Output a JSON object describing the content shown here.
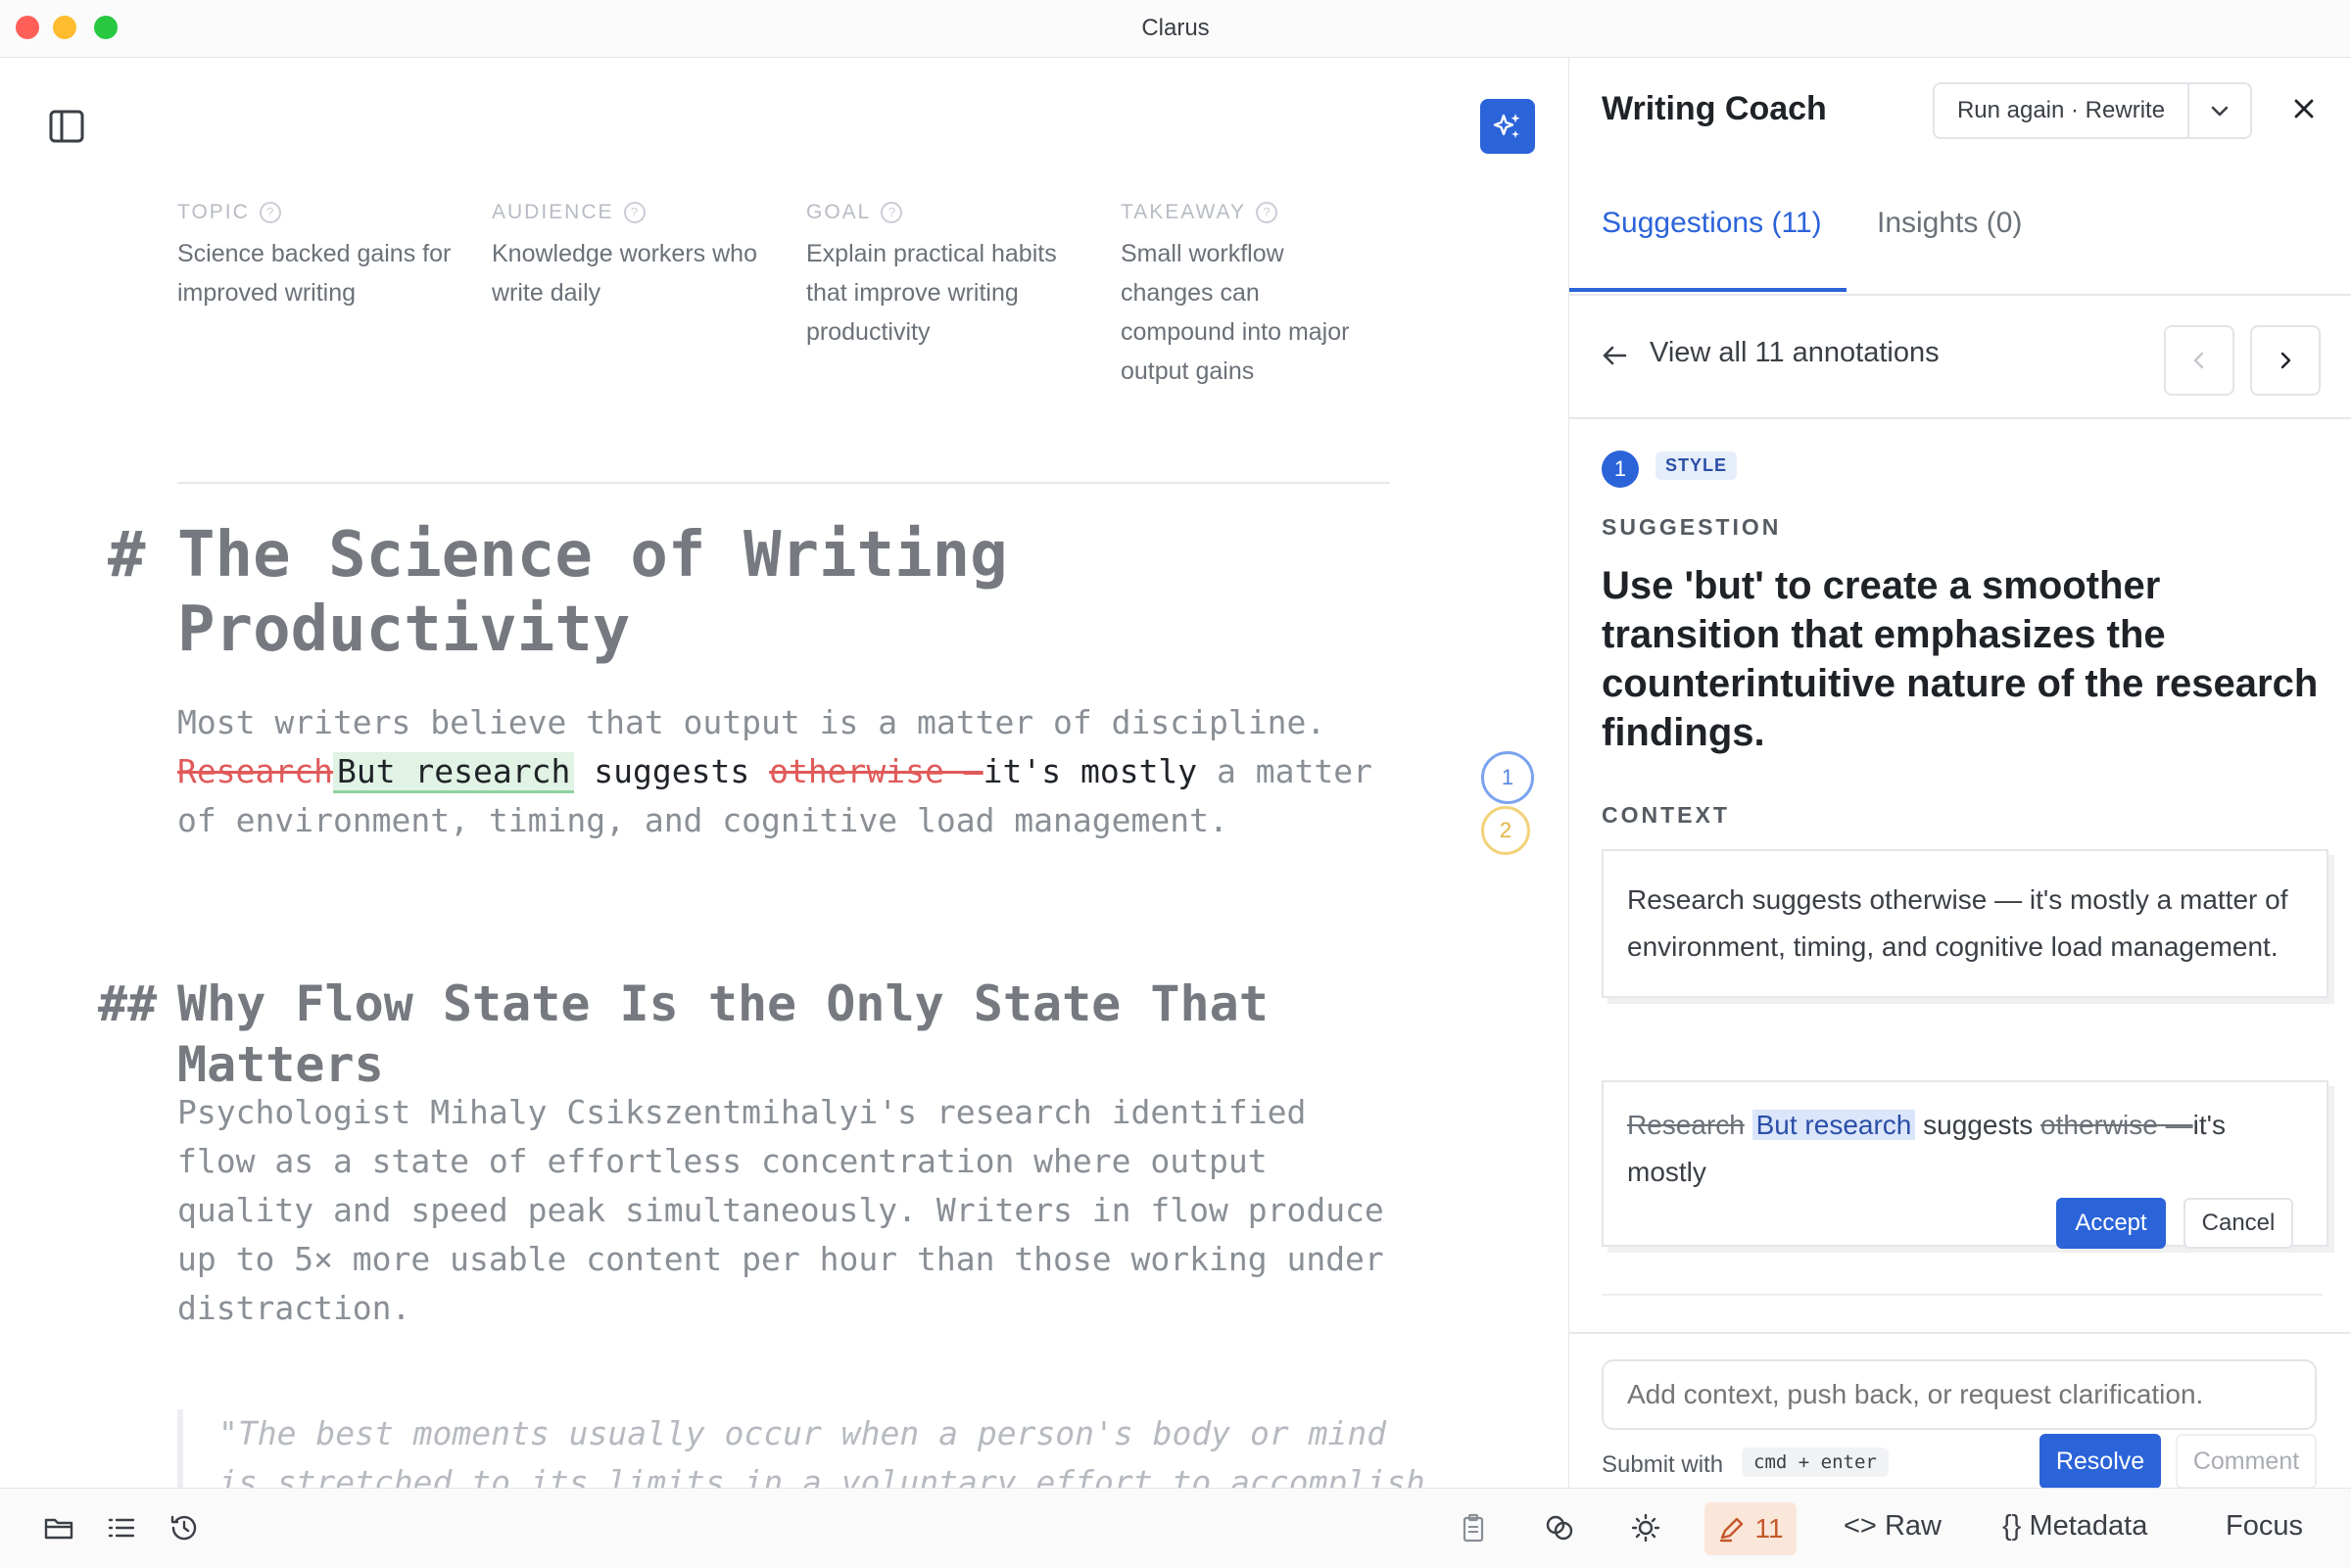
{
  "window": {
    "title": "Clarus"
  },
  "meta": [
    {
      "label": "TOPIC",
      "value": "Science backed gains for improved writing"
    },
    {
      "label": "AUDIENCE",
      "value": "Knowledge workers who write daily"
    },
    {
      "label": "GOAL",
      "value": "Explain practical habits that improve writing productivity"
    },
    {
      "label": "TAKEAWAY",
      "value": "Small workflow changes can compound into major output gains"
    }
  ],
  "doc": {
    "h1_marker": "#",
    "h1": "The Science of Writing Productivity",
    "p1_line1": "Most writers believe that output is a matter of discipline.",
    "p1_deleted1": "Research",
    "p1_inserted": "But research",
    "p1_mid": "suggests",
    "p1_deleted2": "otherwise —",
    "p1_after": "it's mostly",
    "p1_rest": "a matter of environment, timing, and cognitive load management.",
    "h2_marker": "##",
    "h2": "Why Flow State Is the Only State That Matters",
    "p2": "Psychologist Mihaly Csikszentmihalyi's research identified flow as a state of effortless concentration where output quality and speed peak simultaneously. Writers in flow produce up to 5× more usable content per hour than those working under distraction.",
    "quote": "\"The best moments usually occur when a person's body or mind is stretched to its limits in a voluntary effort to accomplish something difficult and worthwhile.\" —"
  },
  "annotations": [
    {
      "number": "1",
      "color": "#7aa3ef"
    },
    {
      "number": "2",
      "color": "#f2d27a"
    }
  ],
  "panel": {
    "title": "Writing Coach",
    "run_again": "Run again · Rewrite",
    "tabs": {
      "suggestions": "Suggestions (11)",
      "insights": "Insights (0)"
    },
    "nav_text": "View all 11 annotations",
    "badge_number": "1",
    "badge_type": "STYLE",
    "suggestion_label": "SUGGESTION",
    "suggestion_text": "Use 'but' to create a smoother transition that emphasizes the counterintuitive nature of the research findings.",
    "context_label": "CONTEXT",
    "context_text": "Research suggests otherwise — it's mostly a matter of environment, timing, and cognitive load management.",
    "edit": {
      "deleted1": "Research",
      "inserted": "But research",
      "mid": "suggests",
      "deleted2": "otherwise —",
      "after": "it's mostly"
    },
    "accept": "Accept",
    "cancel": "Cancel",
    "reply_placeholder": "Add context, push back, or request clarification.",
    "submit_hint": "Submit with",
    "shortcut": "cmd + enter",
    "resolve": "Resolve",
    "comment": "Comment"
  },
  "bottombar": {
    "annotation_count": "11",
    "raw": "Raw",
    "metadata": "Metadata",
    "focus": "Focus"
  },
  "colors": {
    "accent": "#2b63d9",
    "deleted": "#e05a5a",
    "inserted_bg": "#e0f3e4",
    "count_pill": "#fbe7da"
  }
}
